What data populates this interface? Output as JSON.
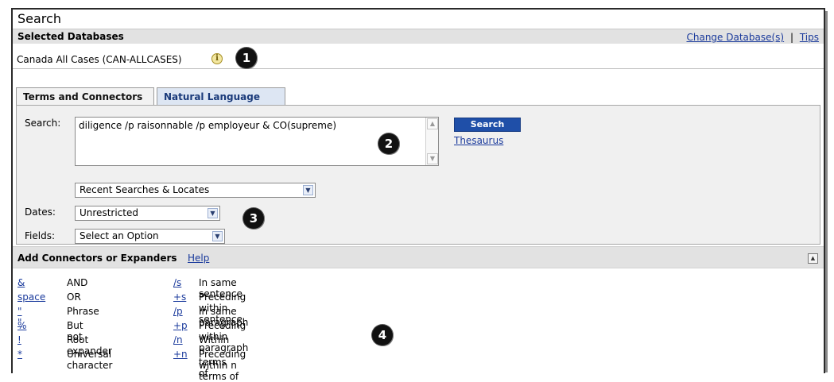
{
  "header": {
    "title": "Search"
  },
  "databases": {
    "heading": "Selected Databases",
    "change_link": "Change Database(s)",
    "separator": "|",
    "tips_link": "Tips",
    "selected": "Canada All Cases (CAN-ALLCASES)",
    "info_icon": "info-icon"
  },
  "callouts": [
    "1",
    "2",
    "3",
    "4"
  ],
  "tabs": [
    {
      "label": "Terms and Connectors",
      "active": true
    },
    {
      "label": "Natural Language",
      "active": false
    }
  ],
  "search": {
    "label": "Search:",
    "query": "diligence /p raisonnable /p employeur & CO(supreme)",
    "button": "Search",
    "thesaurus": "Thesaurus",
    "recent": "Recent Searches & Locates"
  },
  "dates": {
    "label": "Dates:",
    "value": "Unrestricted"
  },
  "fields": {
    "label": "Fields:",
    "value": "Select an Option"
  },
  "connectors": {
    "heading": "Add Connectors or Expanders",
    "help": "Help",
    "left": [
      {
        "symbol": "&",
        "name": "AND"
      },
      {
        "symbol": "space",
        "name": "OR"
      },
      {
        "symbol": "\" \"",
        "name": "Phrase"
      },
      {
        "symbol": "%",
        "name": "But not"
      },
      {
        "symbol": "!",
        "name": "Root expander"
      },
      {
        "symbol": "*",
        "name": "Universal character"
      }
    ],
    "right": [
      {
        "symbol": "/s",
        "name": "In same sentence"
      },
      {
        "symbol": "+s",
        "name": "Preceding within sentence"
      },
      {
        "symbol": "/p",
        "name": "In same paragraph"
      },
      {
        "symbol": "+p",
        "name": "Preceding within paragraph"
      },
      {
        "symbol": "/n",
        "name": "Within n terms of"
      },
      {
        "symbol": "+n",
        "name": "Preceding within n terms of"
      }
    ]
  },
  "colors": {
    "link": "#1a3a9c",
    "button": "#1f4fa8",
    "tab_alt": "#dde6f3",
    "panel": "#f0f0f0"
  }
}
